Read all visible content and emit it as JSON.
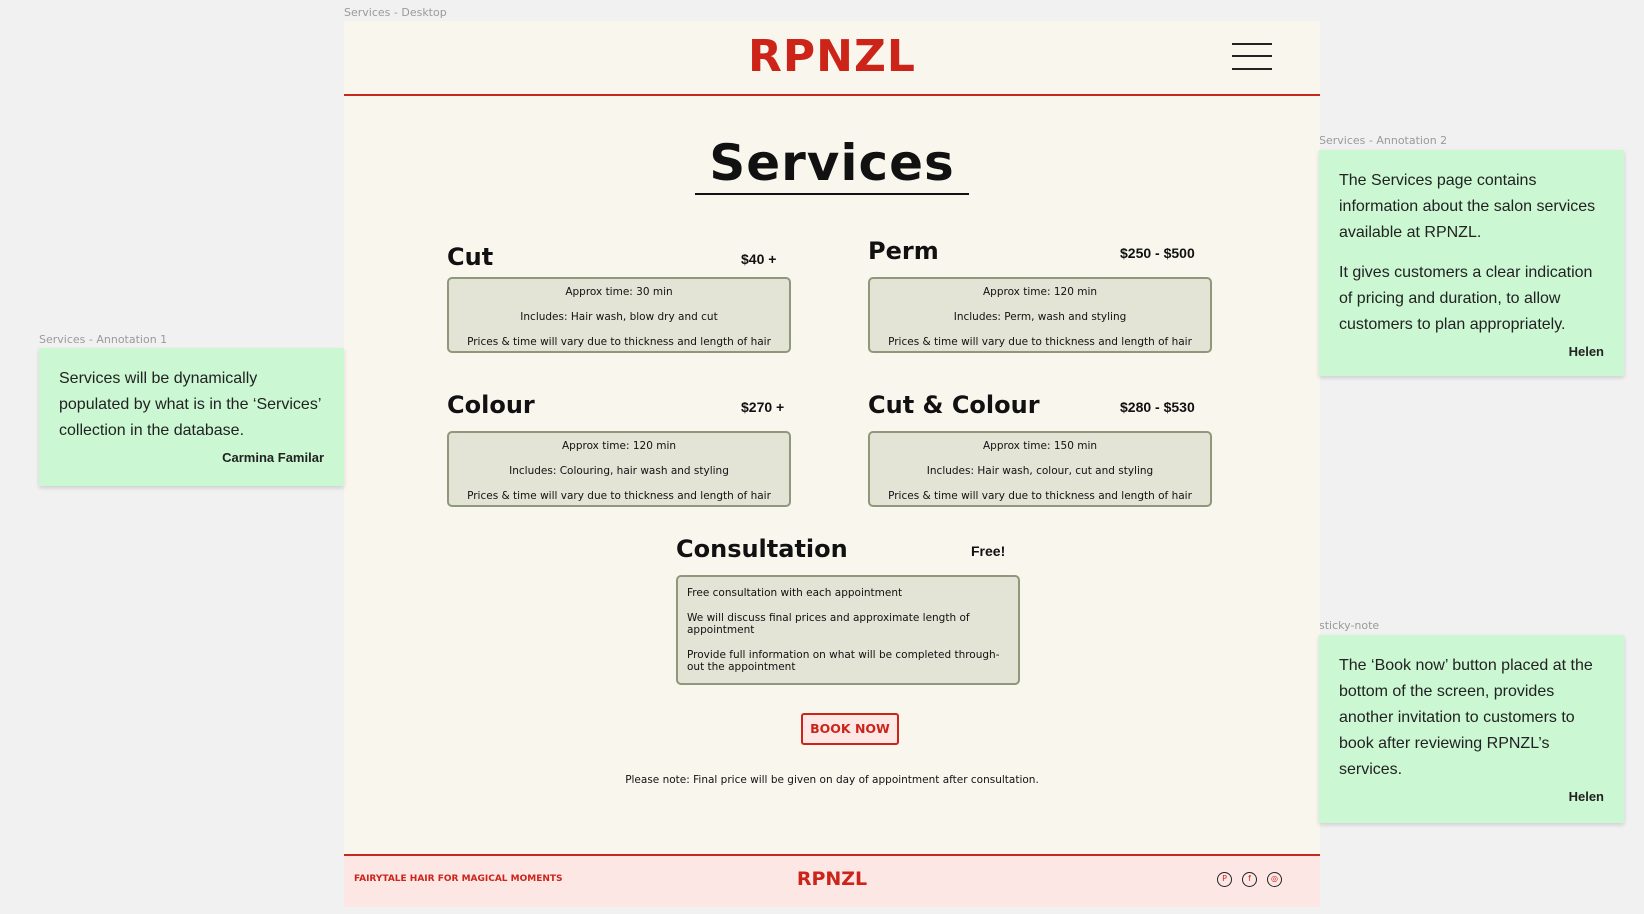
{
  "frame_labels": {
    "desktop": "Services - Desktop",
    "annotation1": "Services - Annotation 1",
    "annotation2": "Services - Annotation 2",
    "sticky": "sticky-note"
  },
  "header": {
    "logo": "RPNZL",
    "menu_icon": "hamburger-menu-icon"
  },
  "page": {
    "title": "Services"
  },
  "services": [
    {
      "name": "Cut",
      "price": "$40 +",
      "lines": [
        "Approx time: 30 min",
        "Includes: Hair wash, blow dry and cut",
        "Prices & time will vary due to thickness and length of hair"
      ]
    },
    {
      "name": "Perm",
      "price": "$250 - $500",
      "lines": [
        "Approx time: 120 min",
        "Includes: Perm, wash and styling",
        "Prices & time will vary due to thickness and length of hair"
      ]
    },
    {
      "name": "Colour",
      "price": "$270 +",
      "lines": [
        "Approx time: 120 min",
        "Includes: Colouring, hair wash and styling",
        "Prices & time will vary due to thickness and length of hair"
      ]
    },
    {
      "name": "Cut & Colour",
      "price": "$280 - $530",
      "lines": [
        "Approx time: 150 min",
        "Includes: Hair wash, colour, cut and styling",
        "Prices & time will vary due to thickness and length of hair"
      ]
    }
  ],
  "consultation": {
    "name": "Consultation",
    "price": "Free!",
    "lines": [
      "Free consultation with each appointment",
      "We will discuss final prices and approximate length of appointment",
      "Provide full information on what will be completed through-out the appointment"
    ]
  },
  "book_now": "BOOK NOW",
  "note": "Please note: Final price will be given on day of appointment after consultation.",
  "footer": {
    "tagline": "FAIRYTALE HAIR FOR MAGICAL MOMENTS",
    "logo": "RPNZL",
    "social_icons": [
      "pinterest-icon",
      "facebook-icon",
      "instagram-icon"
    ]
  },
  "annotations": {
    "a1": {
      "text": [
        "Services will be dynamically populated by what is in the ‘Services’ collection in the database."
      ],
      "author": "Carmina Familar"
    },
    "a2": {
      "text": [
        "The Services page contains information about the salon services available at RPNZL.",
        "It gives customers a clear indication of pricing and duration, to allow customers to plan appropriately."
      ],
      "author": "Helen"
    },
    "a3": {
      "text": [
        "The ‘Book now’ button placed at the bottom of the screen, provides another invitation to customers to book after reviewing RPNZL’s services."
      ],
      "author": "Helen"
    }
  },
  "colors": {
    "brand_red": "#cc2419",
    "box_fill": "#e3e4d6",
    "box_border": "#8f987a",
    "sticky_green": "#cbf7d3",
    "footer_pink": "#fde7e5",
    "page_bg": "#f9f6ee"
  }
}
